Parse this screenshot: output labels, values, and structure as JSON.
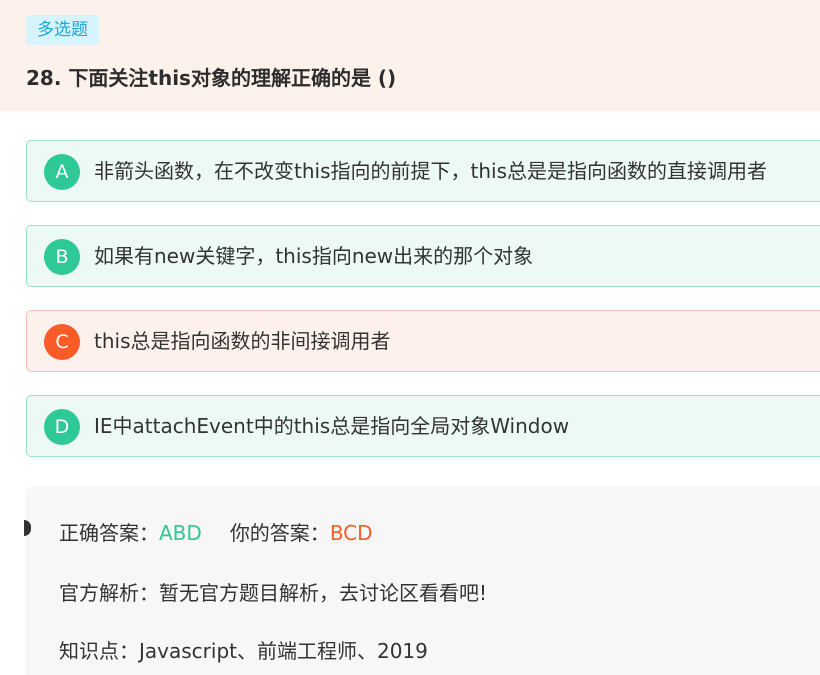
{
  "question": {
    "type_tag": "多选题",
    "title": "28. 下面关注this对象的理解正确的是 ()"
  },
  "options": [
    {
      "letter": "A",
      "text": "非箭头函数，在不改变this指向的前提下，this总是是指向函数的直接调用者",
      "state": "correct"
    },
    {
      "letter": "B",
      "text": "如果有new关键字，this指向new出来的那个对象",
      "state": "correct"
    },
    {
      "letter": "C",
      "text": "this总是指向函数的非间接调用者",
      "state": "wrong"
    },
    {
      "letter": "D",
      "text": "IE中attachEvent中的this总是指向全局对象Window",
      "state": "correct"
    }
  ],
  "result": {
    "correct_label": "正确答案：",
    "correct_value": "ABD",
    "yours_label": "你的答案：",
    "yours_value": "BCD",
    "analysis": "官方解析：暂无官方题目解析，去讨论区看看吧!",
    "knowledge": "知识点：Javascript、前端工程师、2019"
  },
  "colors": {
    "correct": "#2ec996",
    "wrong": "#fb5c27",
    "tag_text": "#1fa7d6",
    "header_bg": "#fdf1ec"
  }
}
